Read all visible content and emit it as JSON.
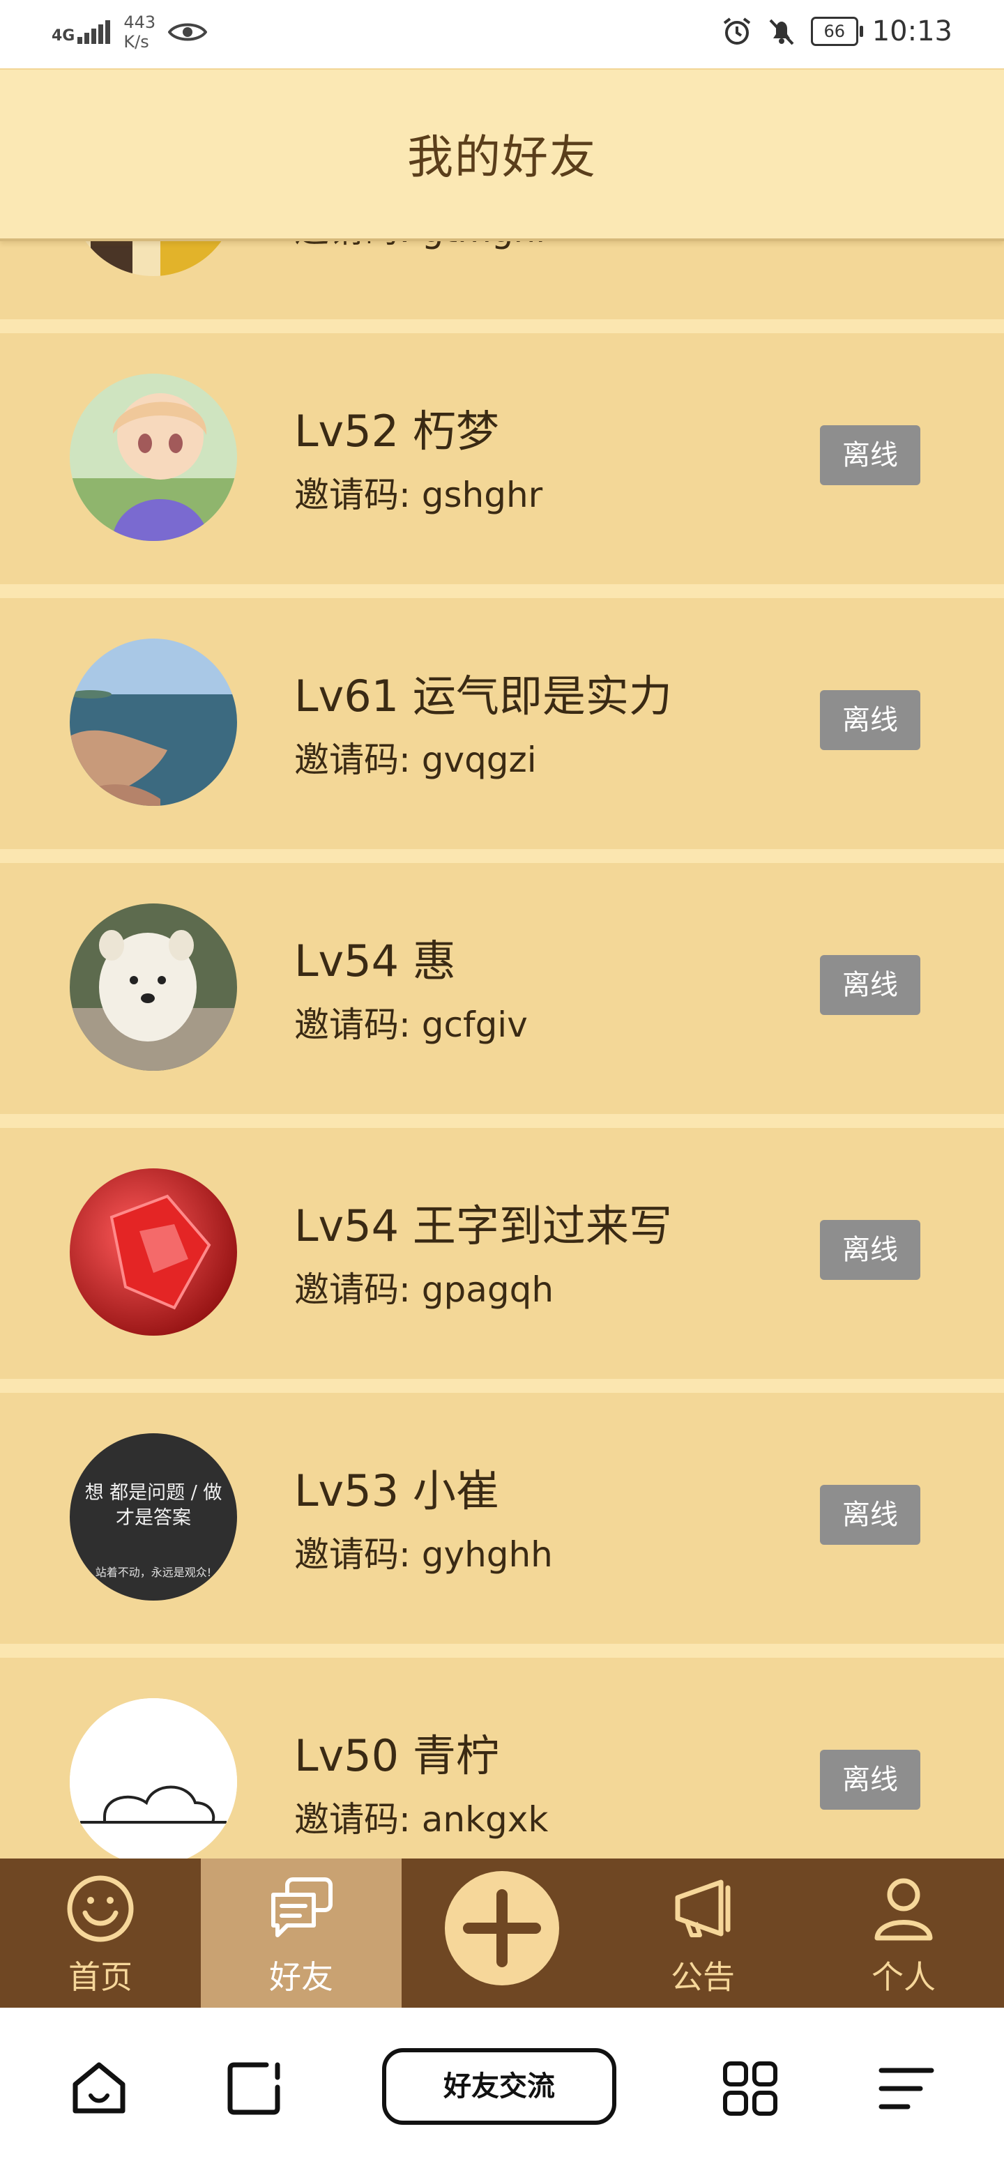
{
  "status_bar": {
    "signal": "4G",
    "net_speed_value": "443",
    "net_speed_unit": "K/s",
    "battery": "66",
    "time": "10:13"
  },
  "header": {
    "title": "我的好友"
  },
  "friends": [
    {
      "name": "",
      "code": "邀请码: gtmghi",
      "status": ""
    },
    {
      "name": "Lv52 朽梦",
      "code": "邀请码: gshghr",
      "status": "离线"
    },
    {
      "name": "Lv61 运气即是实力",
      "code": "邀请码: gvqgzi",
      "status": "离线"
    },
    {
      "name": "Lv54 惠",
      "code": "邀请码: gcfgiv",
      "status": "离线"
    },
    {
      "name": "Lv54 王字到过来写",
      "code": "邀请码: gpagqh",
      "status": "离线"
    },
    {
      "name": "Lv53 小崔",
      "code": "邀请码: gyhghh",
      "status": "离线",
      "avatar_text": "想 都是问题 / 做 才是答案",
      "avatar_caption": "站着不动，永远是观众!"
    },
    {
      "name": "Lv50 青柠",
      "code": "邀请码: ankgxk",
      "status": "离线"
    }
  ],
  "tabs": [
    {
      "label": "首页",
      "icon": "smiley-icon",
      "active": false
    },
    {
      "label": "好友",
      "icon": "chat-bubbles-icon",
      "active": true
    },
    {
      "label": "",
      "icon": "plus-icon",
      "active": false
    },
    {
      "label": "公告",
      "icon": "megaphone-icon",
      "active": false
    },
    {
      "label": "个人",
      "icon": "person-icon",
      "active": false
    }
  ],
  "system_nav": {
    "center_label": "好友交流"
  },
  "colors": {
    "background": "#f3d797",
    "header": "#fbe8b4",
    "tabbar": "#6f4723",
    "tab_active": "#c9a272",
    "offline_badge": "#8e8e8e"
  }
}
